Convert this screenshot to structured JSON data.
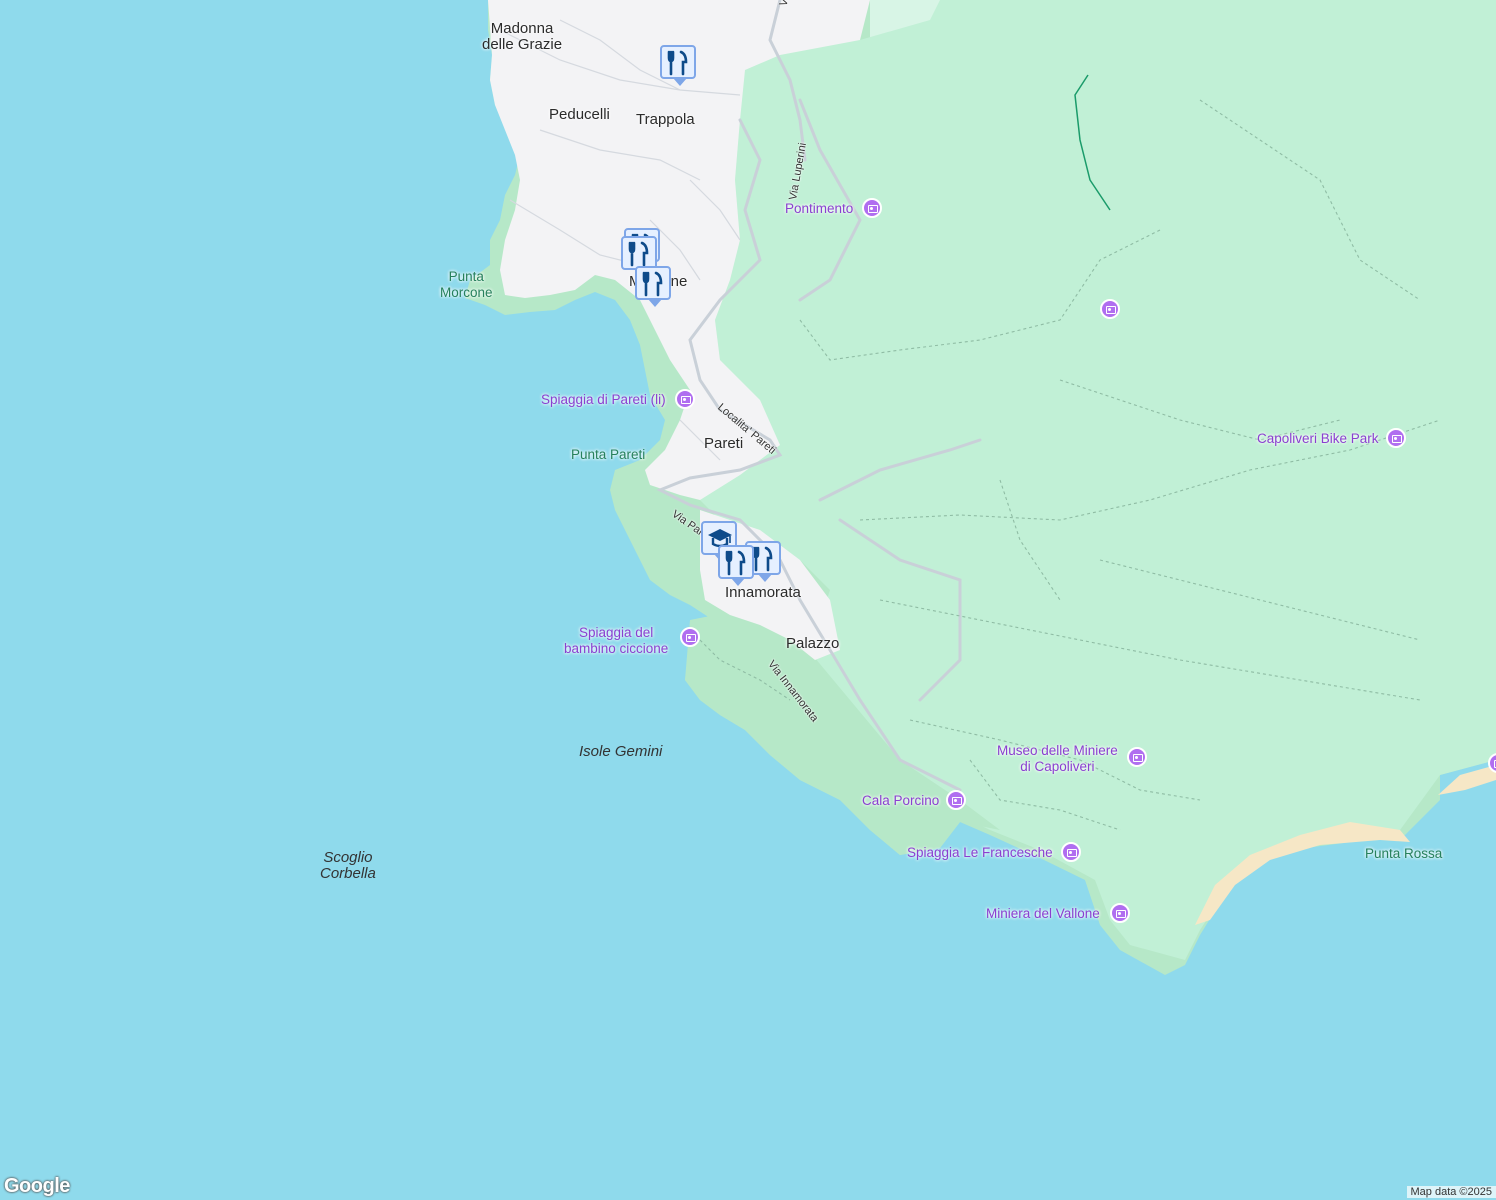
{
  "map": {
    "colors": {
      "sea": "#8fdaec",
      "land_urban": "#f3f3f5",
      "land_park": "#c1f0d6",
      "land_light": "#d8f5e6",
      "coast_green": "#b6e8c8",
      "beach": "#f6e7c6",
      "poi_purple": "#8a3fd0",
      "pin_blue": "#0e4b8a"
    },
    "towns": {
      "madonna": "Madonna\ndelle Grazie",
      "peducelli": "Peducelli",
      "trappola": "Trappola",
      "morcone": "Morcone",
      "pareti": "Pareti",
      "innamorata": "Innamorata",
      "palazzo": "Palazzo"
    },
    "natural": {
      "punta_morcone": "Punta\nMorcone",
      "punta_pareti": "Punta Pareti",
      "punta_rossa": "Punta Rossa"
    },
    "water": {
      "isole_gemini": "Isole Gemini",
      "scoglio_corbella": "Scoglio\nCorbella"
    },
    "roads": {
      "via_v": "Via",
      "via_luperini": "Via Luperini",
      "localita_pareti": "Localita' Pareti",
      "via_pareti": "Via Par",
      "via_innamorata": "Via Innamorata"
    },
    "pois": {
      "pontimento": "Pontimento",
      "spiaggia_pareti": "Spiaggia di Pareti (li)",
      "capoliveri_bike": "Capoliveri Bike Park",
      "spiaggia_bambino": "Spiaggia del\nbambino ciccione",
      "museo": "Museo delle Miniere\ndi Capoliveri",
      "cala_porcino": "Cala Porcino",
      "spiaggia_francesche": "Spiaggia Le Francesche",
      "miniera_vallone": "Miniera del Vallone"
    },
    "icons": {
      "camera": "camera-icon",
      "restaurant": "restaurant-icon",
      "school": "school-icon"
    },
    "credit": "Map data ©2025",
    "logo": "Google"
  }
}
